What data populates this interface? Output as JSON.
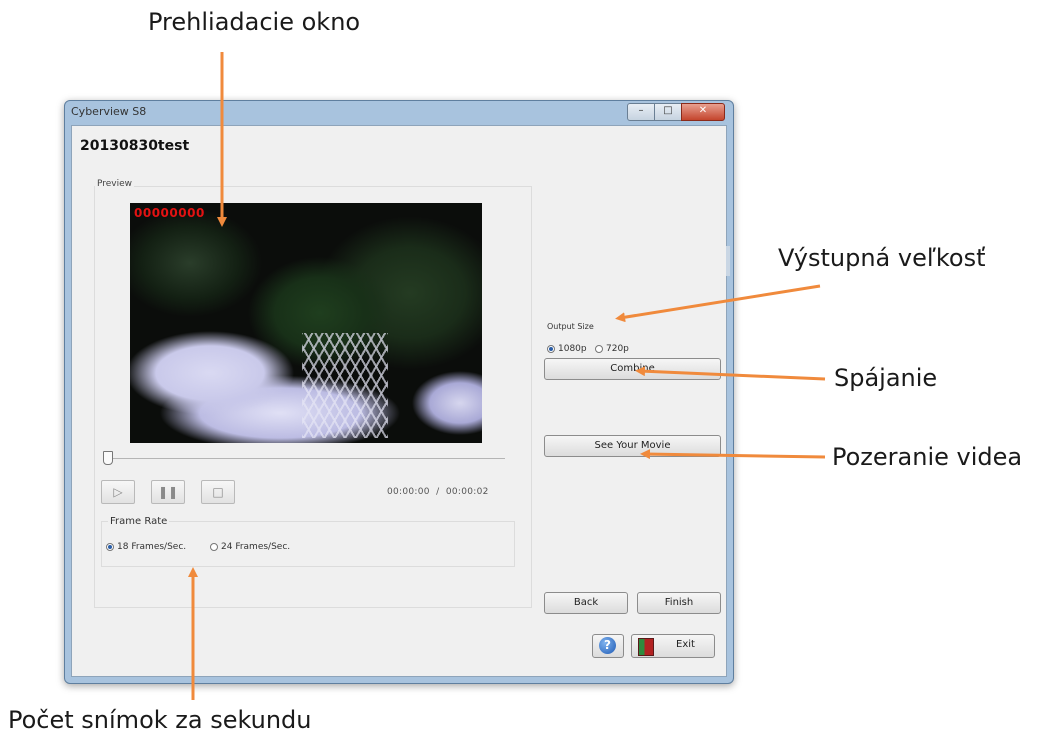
{
  "annotations": {
    "preview": "Prehliadacie okno",
    "output_size": "Výstupná veľkosť",
    "combine": "Spájanie",
    "watch": "Pozeranie videa",
    "frame_rate": "Počet snímok za sekundu"
  },
  "window": {
    "title": "Cyberview S8",
    "project_name": "20130830test"
  },
  "preview": {
    "label": "Preview",
    "frame_counter": "00000000",
    "time_current": "00:00:00",
    "time_separator": "/",
    "time_total": "00:00:02",
    "slider_position": 0
  },
  "frame_rate": {
    "label": "Frame Rate",
    "options": [
      "18 Frames/Sec.",
      "24 Frames/Sec."
    ],
    "selected": "18 Frames/Sec."
  },
  "output_size": {
    "label": "Output Size",
    "options": [
      "1080p",
      "720p"
    ],
    "selected": "1080p"
  },
  "buttons": {
    "combine": "Combine",
    "see_movie": "See Your Movie",
    "back": "Back",
    "finish": "Finish",
    "help": "?",
    "exit": "Exit"
  },
  "colors": {
    "annotation_arrow": "#f08a3c",
    "frame_counter": "#e31212",
    "window_frame": "#a8c3de"
  }
}
